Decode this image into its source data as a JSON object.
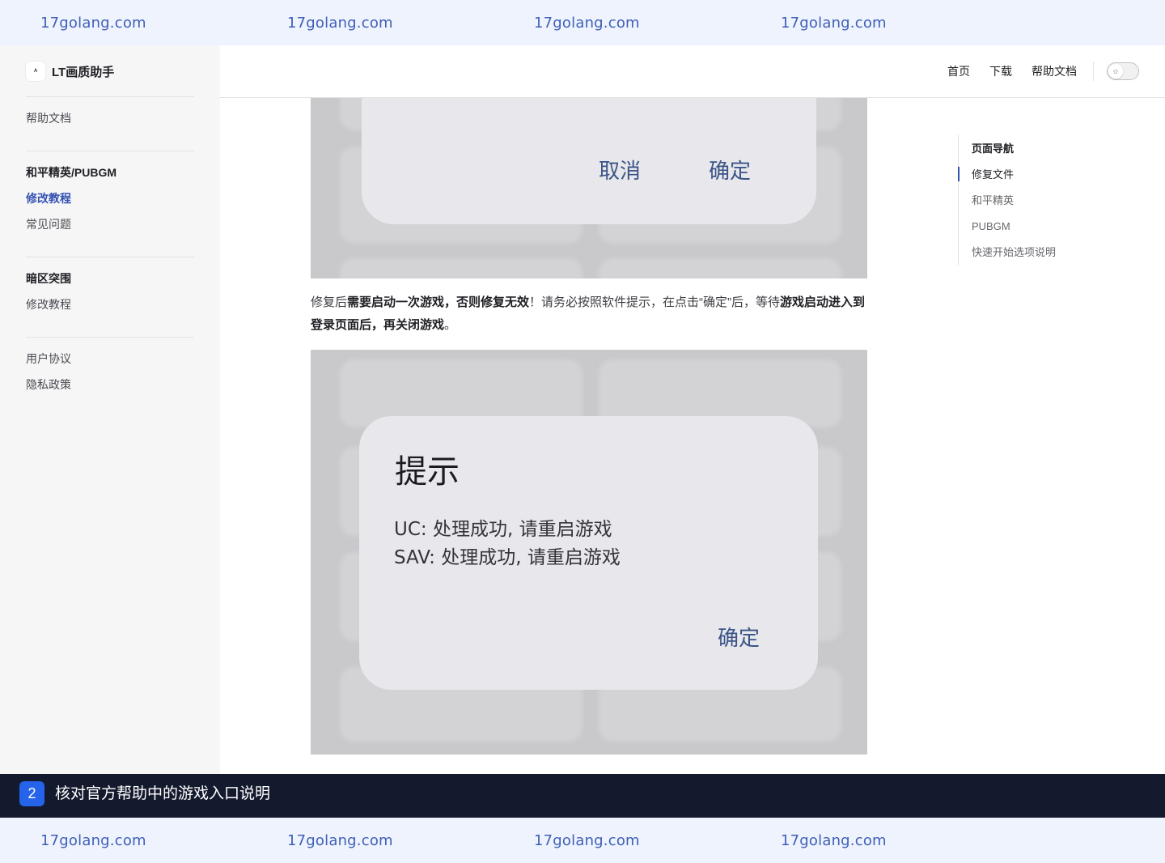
{
  "watermark": {
    "text": "17golang.com"
  },
  "sidebar": {
    "brand": {
      "logo_glyph": "ᴬ",
      "name": "LT画质助手"
    },
    "help_docs": "帮助文档",
    "group_pubgm": {
      "title": "和平精英/PUBGM",
      "items": [
        "修改教程",
        "常见问题"
      ]
    },
    "group_dark": {
      "title": "暗区突围",
      "items": [
        "修改教程"
      ]
    },
    "legal": [
      "用户协议",
      "隐私政策"
    ]
  },
  "topnav": {
    "links": [
      "首页",
      "下载",
      "帮助文档"
    ],
    "theme_toggle_icon": "sun-icon"
  },
  "screenshot1": {
    "cancel": "取消",
    "confirm": "确定"
  },
  "paragraph": {
    "p1": "修复后",
    "b1": "需要启动一次游戏，否则修复无效",
    "p2": "！请务必按照软件提示，在点击“确定”后，等待",
    "b2": "游戏启动进入到登录页面后，再关闭游戏",
    "p3": "。"
  },
  "screenshot2": {
    "title": "提示",
    "line1": "UC: 处理成功, 请重启游戏",
    "line2": "SAV: 处理成功, 请重启游戏",
    "confirm": "确定"
  },
  "outline": {
    "title": "页面导航",
    "items": [
      "修复文件",
      "和平精英",
      "PUBGM",
      "快速开始选项说明"
    ]
  },
  "banner": {
    "step": "2",
    "text": "核对官方帮助中的游戏入口说明"
  },
  "colors": {
    "accent": "#3451b2",
    "banner_bg": "#141a2e",
    "step_badge": "#2563eb",
    "watermark_bg": "#eef3fe"
  }
}
